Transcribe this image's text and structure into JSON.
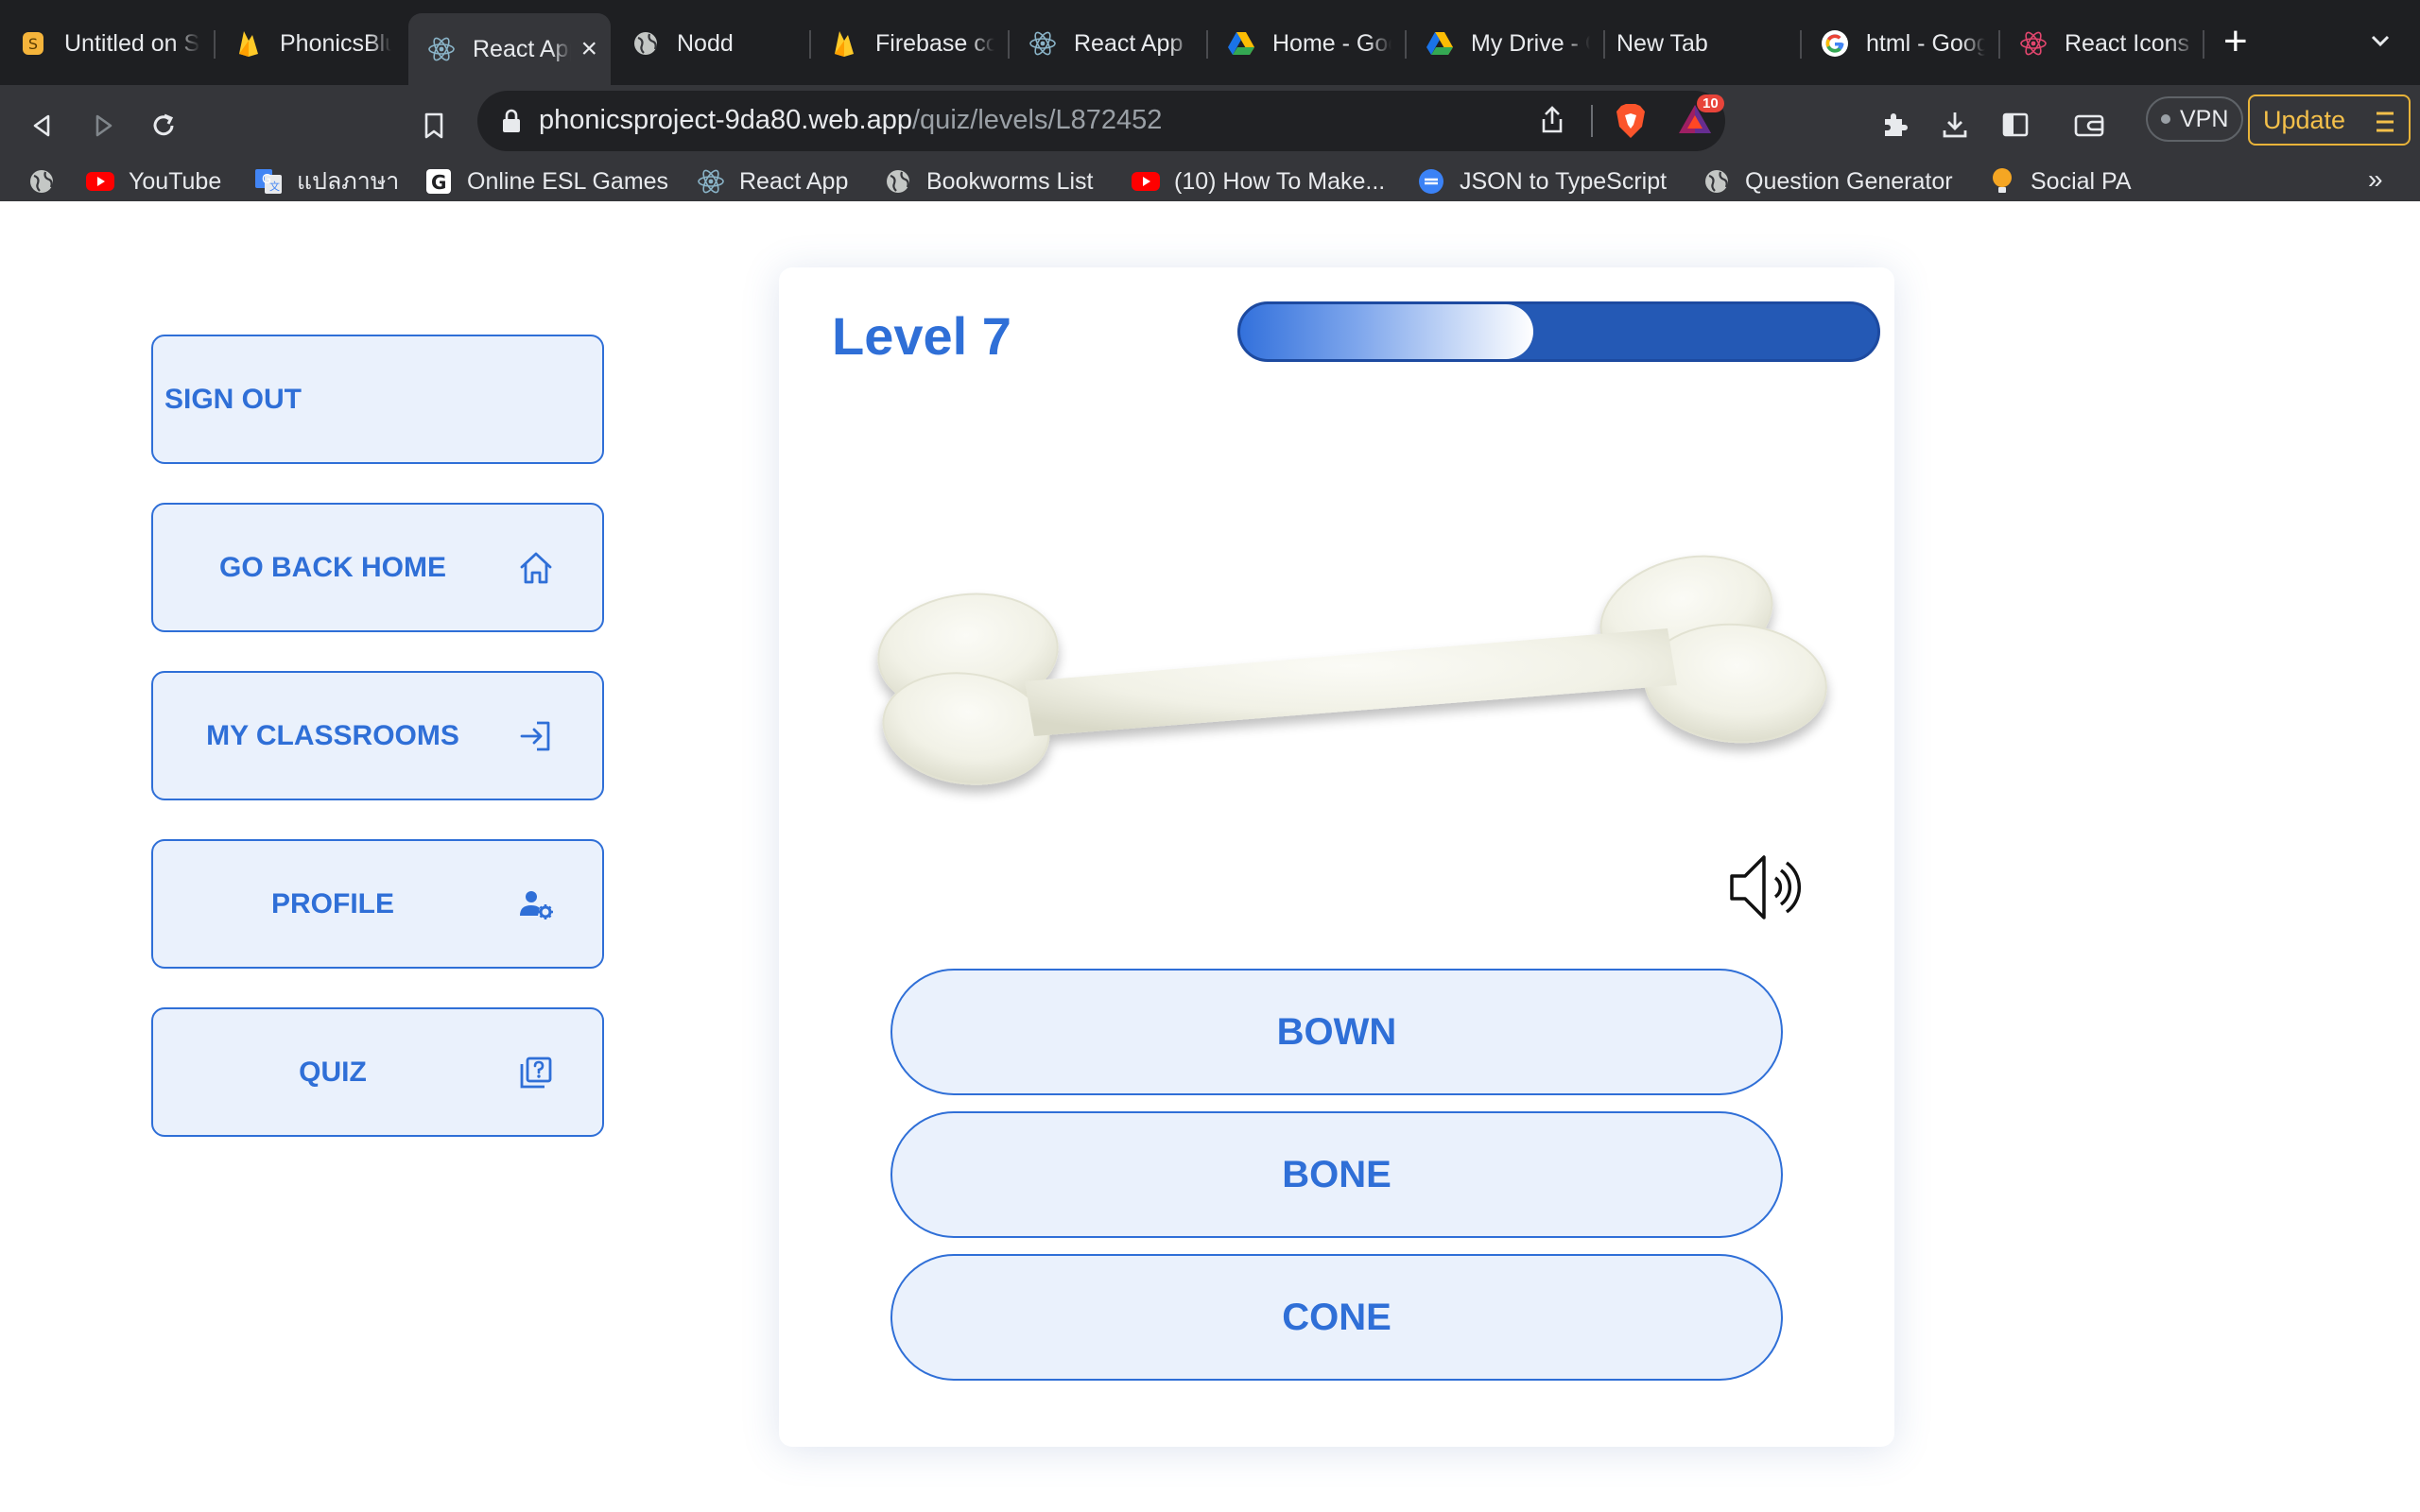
{
  "browser": {
    "tabs": [
      {
        "title": "Untitled on Supernova",
        "icon": "supernova-icon"
      },
      {
        "title": "PhonicsBlue",
        "icon": "firebase-icon"
      },
      {
        "title": "React App",
        "icon": "react-icon",
        "active": true
      },
      {
        "title": "Nodd",
        "icon": "globe-icon"
      },
      {
        "title": "Firebase console",
        "icon": "firebase-icon"
      },
      {
        "title": "React App",
        "icon": "react-icon"
      },
      {
        "title": "Home - Google Drive",
        "icon": "google-drive-icon"
      },
      {
        "title": "My Drive - Google Drive",
        "icon": "google-drive-icon"
      },
      {
        "title": "New Tab",
        "icon": ""
      },
      {
        "title": "html - Google Search",
        "icon": "google-icon"
      },
      {
        "title": "React Icons",
        "icon": "react-icon"
      }
    ],
    "url_host": "phonicsproject-9da80.web.app",
    "url_path": "/quiz/levels/L872452",
    "brave_badge": "10",
    "vpn_label": "VPN",
    "update_label": "Update",
    "bookmarks": [
      {
        "label": "",
        "icon": "globe-icon"
      },
      {
        "label": "YouTube",
        "icon": "youtube-icon"
      },
      {
        "label": "แปลภาษา",
        "icon": "google-translate-icon"
      },
      {
        "label": "Online ESL Games",
        "icon": "esl-games-icon"
      },
      {
        "label": "React App",
        "icon": "react-icon"
      },
      {
        "label": "Bookworms List",
        "icon": "globe-icon"
      },
      {
        "label": "(10) How To Make...",
        "icon": "youtube-icon"
      },
      {
        "label": "JSON to TypeScript",
        "icon": "json-icon"
      },
      {
        "label": "Question Generator",
        "icon": "globe-icon"
      },
      {
        "label": "Social PA",
        "icon": "lightbulb-icon"
      }
    ],
    "bookmarks_more": "»"
  },
  "sidebar": {
    "sign_out": "SIGN OUT",
    "go_back_home": "GO BACK HOME",
    "my_classrooms": "MY CLASSROOMS",
    "profile": "PROFILE",
    "quiz": "QUIZ"
  },
  "quiz": {
    "level_title": "Level 7",
    "progress": 0.46,
    "image_subject": "bone",
    "answers": [
      "BOWN",
      "BONE",
      "CONE"
    ]
  },
  "colors": {
    "accent": "#2f6fd7",
    "button_bg": "#eaf1fc",
    "progress_track": "#2459b5"
  }
}
